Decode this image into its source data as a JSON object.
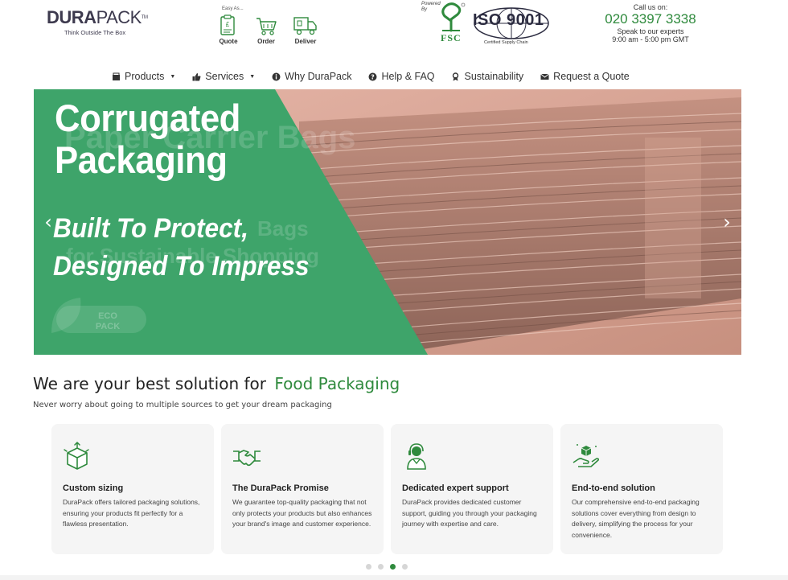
{
  "header": {
    "logo": {
      "brand_bold": "DURA",
      "brand_light": "PACK",
      "tm": "TM",
      "tagline": "Think Outside The Box"
    },
    "easy_as": "Easy As...",
    "steps": [
      {
        "label": "Quote",
        "icon": "clipboard-pound-icon"
      },
      {
        "label": "Order",
        "icon": "shopping-cart-icon"
      },
      {
        "label": "Deliver",
        "icon": "delivery-truck-icon"
      }
    ],
    "certs": {
      "powered_by": [
        "Powered",
        "By"
      ],
      "fsc": "FSC",
      "iso": "ISO 9001",
      "iso_sub": "Certified Supply Chain"
    },
    "contact": {
      "call_label": "Call us on:",
      "phone": "020 3397 3338",
      "speak": "Speak to our experts",
      "hours": "9:00 am - 5:00 pm GMT"
    }
  },
  "nav": {
    "items": [
      {
        "label": "Products",
        "icon": "box-icon",
        "dropdown": true
      },
      {
        "label": "Services",
        "icon": "thumbs-up-icon",
        "dropdown": true
      },
      {
        "label": "Why DuraPack",
        "icon": "info-icon",
        "dropdown": false
      },
      {
        "label": "Help & FAQ",
        "icon": "question-icon",
        "dropdown": false
      },
      {
        "label": "Sustainability",
        "icon": "award-icon",
        "dropdown": false
      },
      {
        "label": "Request a Quote",
        "icon": "envelope-icon",
        "dropdown": false
      }
    ]
  },
  "hero": {
    "title_line1": "Corrugated",
    "title_line2": "Packaging",
    "subtitle_line1": "Built To Protect,",
    "subtitle_line2": "Designed To Impress",
    "ghost_title": "Paper Carrier Bags",
    "ghost_sub1": "Bags",
    "ghost_sub2": "for Sustainable Shopping",
    "eco_badge": [
      "ECO",
      "PACK"
    ],
    "prev_icon": "chevron-left-icon",
    "next_icon": "chevron-right-icon",
    "accent_color": "#3ea46a"
  },
  "solutions": {
    "title": "We are your best solution for",
    "highlight": "Food Packaging",
    "subtitle": "Never worry about going to multiple sources to get your dream packaging",
    "cards": [
      {
        "icon": "box-resize-icon",
        "title": "Custom sizing",
        "text": "DuraPack offers tailored packaging solutions, ensuring your products fit perfectly for a flawless presentation."
      },
      {
        "icon": "handshake-icon",
        "title": "The DuraPack Promise",
        "text": "We guarantee top-quality packaging that not only protects your products but also enhances your brand's image and customer experience."
      },
      {
        "icon": "support-agent-icon",
        "title": "Dedicated expert support",
        "text": "DuraPack provides dedicated customer support, guiding you through your packaging journey with expertise and care."
      },
      {
        "icon": "hand-package-icon",
        "title": "End-to-end solution",
        "text": "Our comprehensive end-to-end packaging solutions cover everything from design to delivery, simplifying the process for your convenience."
      }
    ],
    "carousel": {
      "total_pages": 4,
      "active_page": 3
    }
  },
  "colors": {
    "brand_green": "#2f8a3d",
    "logo_dark": "#3d3a4e"
  }
}
